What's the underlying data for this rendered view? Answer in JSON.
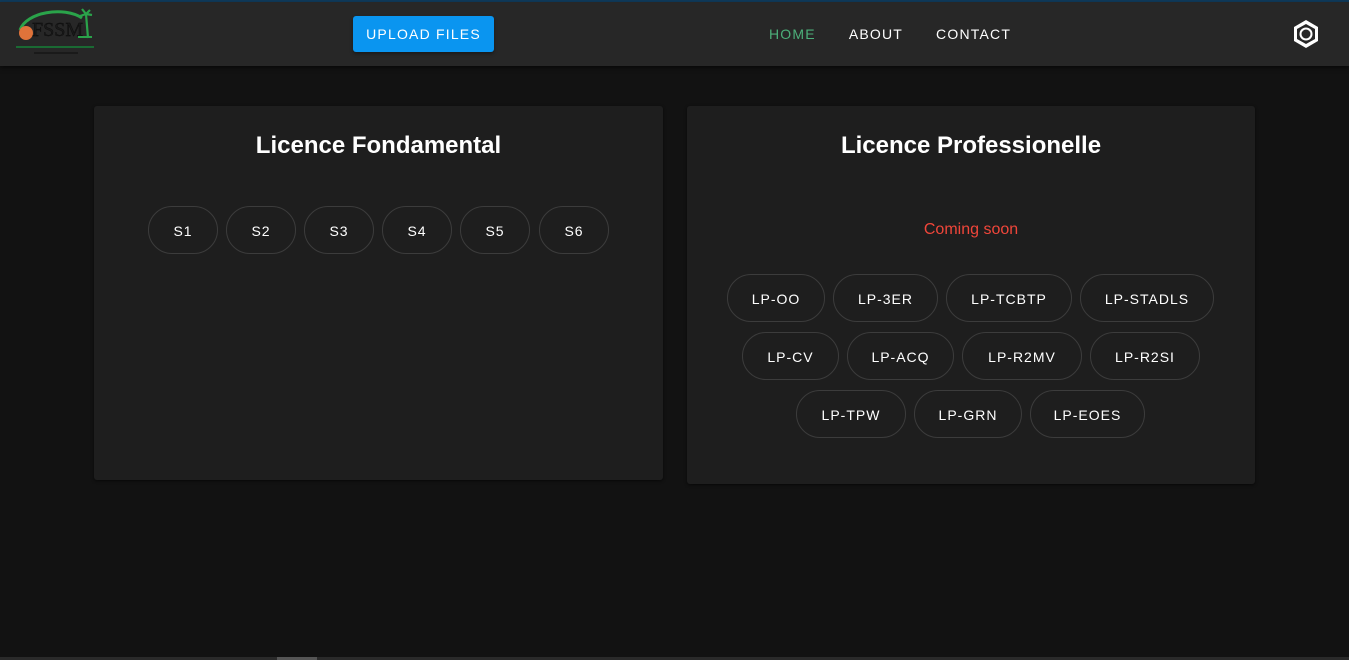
{
  "header": {
    "logo_text": "FSSM",
    "upload_label": "UPLOAD FILES",
    "nav": [
      {
        "label": "HOME",
        "active": true
      },
      {
        "label": "ABOUT",
        "active": false
      },
      {
        "label": "CONTACT",
        "active": false
      }
    ],
    "theme_icon": "brightness-icon"
  },
  "cards": {
    "fondamental": {
      "title": "Licence Fondamental",
      "semesters": [
        "S1",
        "S2",
        "S3",
        "S4",
        "S5",
        "S6"
      ]
    },
    "professionnelle": {
      "title": "Licence Professionelle",
      "notice": "Coming soon",
      "programs": [
        "LP-OO",
        "LP-3ER",
        "LP-TCBTP",
        "LP-STADLS",
        "LP-CV",
        "LP-ACQ",
        "LP-R2MV",
        "LP-R2SI",
        "LP-TPW",
        "LP-GRN",
        "LP-EOES"
      ]
    }
  },
  "colors": {
    "accent": "#0a95f0",
    "active_nav": "#4caf7a",
    "notice": "#f0463a",
    "background": "#121212",
    "surface": "#1e1e1e"
  }
}
